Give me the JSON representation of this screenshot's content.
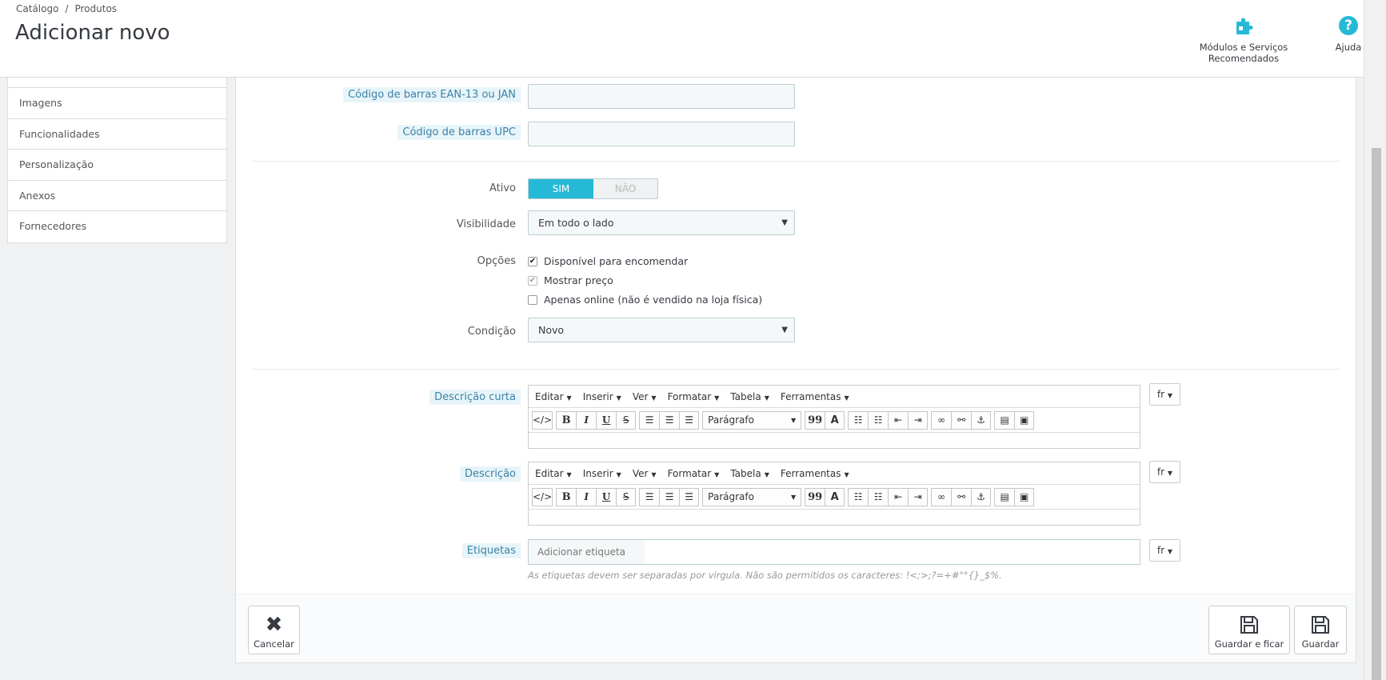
{
  "breadcrumb": {
    "parent": "Catálogo",
    "separator": "/",
    "current": "Produtos"
  },
  "page_title": "Adicionar novo",
  "toolbar": {
    "modules_label": "Módulos e Serviços Recomendados",
    "modules_icon": "puzzle-icon",
    "help_label": "Ajuda",
    "help_icon": "help-icon",
    "help_glyph": "?"
  },
  "sidebar": {
    "items": [
      {
        "label": "Imagens"
      },
      {
        "label": "Funcionalidades"
      },
      {
        "label": "Personalização"
      },
      {
        "label": "Anexos"
      },
      {
        "label": "Fornecedores"
      }
    ]
  },
  "form": {
    "ean_label": "Código de barras EAN-13 ou JAN",
    "ean_value": "",
    "upc_label": "Código de barras UPC",
    "upc_value": "",
    "active_label": "Ativo",
    "active_on": "SIM",
    "active_off": "NÃO",
    "visibility_label": "Visibilidade",
    "visibility_value": "Em todo o lado",
    "options_label": "Opções",
    "options": [
      {
        "label": "Disponível para encomendar",
        "checked": true
      },
      {
        "label": "Mostrar preço",
        "checked": true
      },
      {
        "label": "Apenas online (não é vendido na loja física)",
        "checked": false
      }
    ],
    "condition_label": "Condição",
    "condition_value": "Novo",
    "short_desc_label": "Descrição curta",
    "desc_label": "Descrição",
    "tags_label": "Etiquetas",
    "tags_placeholder": "Adicionar etiqueta",
    "tags_help": "As etiquetas devem ser separadas por vírgula. Não são permitidos os caracteres: !<;>;?=+#\"°{}_$%.",
    "lang": "fr"
  },
  "editor": {
    "menu": [
      "Editar",
      "Inserir",
      "Ver",
      "Formatar",
      "Tabela",
      "Ferramentas"
    ],
    "format_value": "Parágrafo",
    "bold": "B",
    "italic": "I",
    "underline": "U",
    "strike": "S",
    "quote": "99",
    "text_color": "A"
  },
  "footer": {
    "cancel_label": "Cancelar",
    "save_stay_label": "Guardar e ficar",
    "save_label": "Guardar"
  },
  "colors": {
    "accent": "#25b9d7",
    "label_highlight_bg": "#e7f5fa",
    "label_highlight_text": "#3c81a6"
  }
}
